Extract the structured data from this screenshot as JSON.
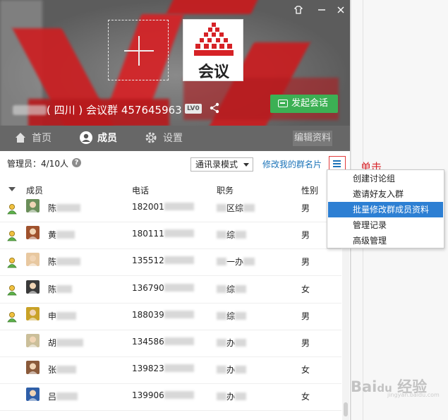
{
  "group": {
    "region": "( 四川 )",
    "name": "会议群",
    "number": "457645963",
    "level_badge": "LV0",
    "logo_text": "会议",
    "start_chat_label": "发起会话"
  },
  "tabs": [
    {
      "label": "首页",
      "active": false
    },
    {
      "label": "成员",
      "active": true
    },
    {
      "label": "设置",
      "active": false
    }
  ],
  "edit_profile_label": "编辑资料",
  "toolbar": {
    "admin_count": "管理员：4/10人",
    "help": "?",
    "mode_label": "通讯录模式",
    "edit_my_card": "修改我的群名片"
  },
  "annotation": "单击",
  "table": {
    "headers": [
      "成员",
      "电话",
      "职务",
      "性别"
    ],
    "rows": [
      {
        "admin": true,
        "name": "陈",
        "phone": "182001",
        "title_pre": "",
        "title_post": "区综",
        "gender": "男"
      },
      {
        "admin": true,
        "name": "黄",
        "phone": "180111",
        "title_pre": "",
        "title_post": "综",
        "gender": "男"
      },
      {
        "admin": true,
        "name": "陈",
        "phone": "135512",
        "title_pre": "",
        "title_post": "一办",
        "gender": "男"
      },
      {
        "admin": true,
        "name": "陈",
        "phone": "136790",
        "title_pre": "",
        "title_post": "综",
        "gender": "女"
      },
      {
        "admin": true,
        "name": "申",
        "phone": "188039",
        "title_pre": "",
        "title_post": "综",
        "gender": "男"
      },
      {
        "admin": false,
        "name": "胡",
        "phone": "134586",
        "title_pre": "",
        "title_post": "办",
        "gender": "男"
      },
      {
        "admin": false,
        "name": "张",
        "phone": "139823",
        "title_pre": "",
        "title_post": "办",
        "gender": "女"
      },
      {
        "admin": false,
        "name": "吕",
        "phone": "139906",
        "title_pre": "",
        "title_post": "办",
        "gender": "女"
      }
    ]
  },
  "menu": {
    "items": [
      {
        "label": "创建讨论组",
        "active": false
      },
      {
        "label": "邀请好友入群",
        "active": false
      },
      {
        "label": "批量修改群成员资料",
        "active": true
      },
      {
        "label": "管理记录",
        "active": false
      },
      {
        "label": "高级管理",
        "active": false
      }
    ]
  },
  "watermark": {
    "brand": "Bai",
    "cn": "经验",
    "sub": "jingyan.baidu.com"
  },
  "colors": {
    "accent_blue": "#2d7fd3",
    "link_blue": "#1b73b8",
    "start_green": "#3cb054",
    "annotation_red": "#d8262b",
    "header_red": "#c81b1e"
  }
}
